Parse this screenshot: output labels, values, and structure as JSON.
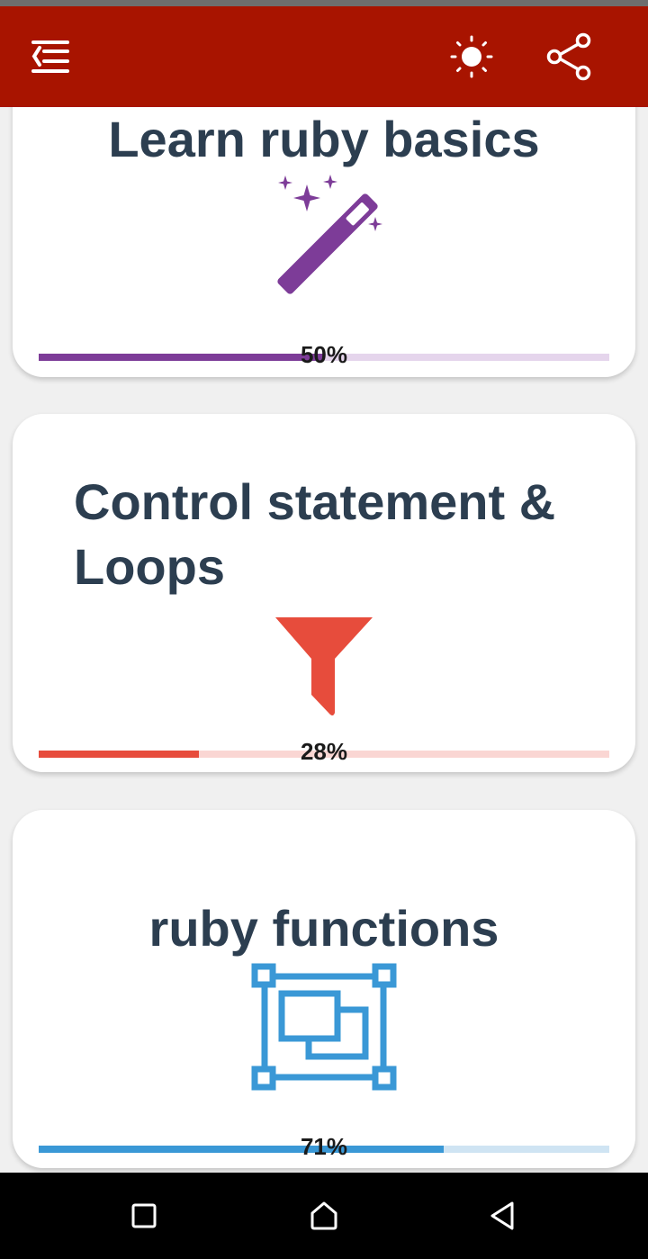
{
  "app_bar": {
    "background": "#a81400",
    "icons": [
      "menu-collapse-icon",
      "brightness-icon",
      "share-icon"
    ]
  },
  "cards": [
    {
      "title": "Learn ruby basics",
      "icon": "magic-wand-icon",
      "progress": 0.5,
      "progress_label": "50%",
      "accent": "#7d3c98",
      "track": "#e5d5ec"
    },
    {
      "title": "Control statement & Loops",
      "icon": "funnel-icon",
      "progress": 0.28,
      "progress_label": "28%",
      "accent": "#e74c3c",
      "track": "#fad6d3"
    },
    {
      "title": "ruby functions",
      "icon": "object-group-icon",
      "progress": 0.71,
      "progress_label": "71%",
      "accent": "#3a98d6",
      "track": "#cfe4f3"
    }
  ],
  "nav_bar": {
    "icons": [
      "recents-square-icon",
      "home-icon",
      "back-triangle-icon"
    ]
  }
}
